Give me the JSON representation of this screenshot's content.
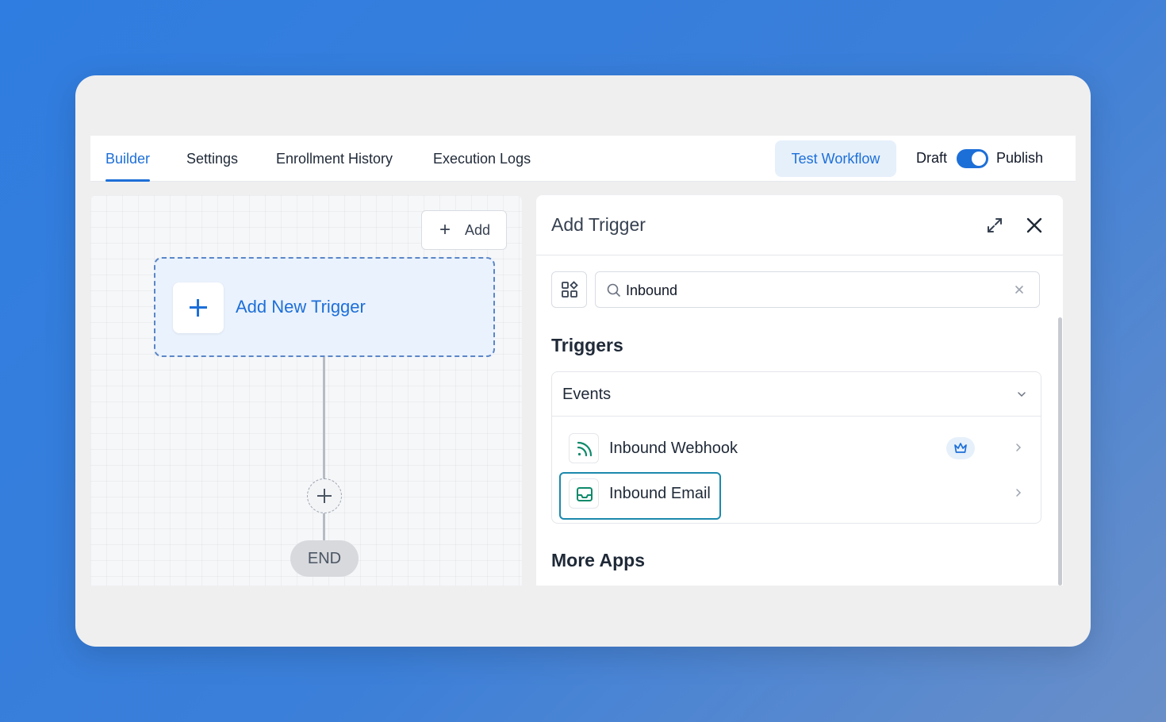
{
  "nav": {
    "tabs": [
      {
        "label": "Builder",
        "active": true
      },
      {
        "label": "Settings"
      },
      {
        "label": "Enrollment History"
      },
      {
        "label": "Execution Logs"
      }
    ],
    "test_workflow_label": "Test Workflow",
    "draft_label": "Draft",
    "publish_label": "Publish",
    "publish_toggle_on": true
  },
  "canvas": {
    "add_label": "Add",
    "trigger_node_label": "Add New Trigger",
    "end_label": "END"
  },
  "panel": {
    "title": "Add Trigger",
    "search": {
      "value": "Inbound"
    },
    "triggers_heading": "Triggers",
    "events_group": {
      "label": "Events",
      "items": [
        {
          "label": "Inbound Webhook",
          "icon": "webhook-icon",
          "badge": "crown-icon"
        },
        {
          "label": "Inbound Email",
          "icon": "email-inbox-icon",
          "focused": true
        }
      ]
    },
    "more_apps_heading": "More Apps"
  },
  "colors": {
    "accent": "#1d6fd8",
    "focus_ring": "#1c89ad",
    "icon_green": "#0e8a6a"
  }
}
